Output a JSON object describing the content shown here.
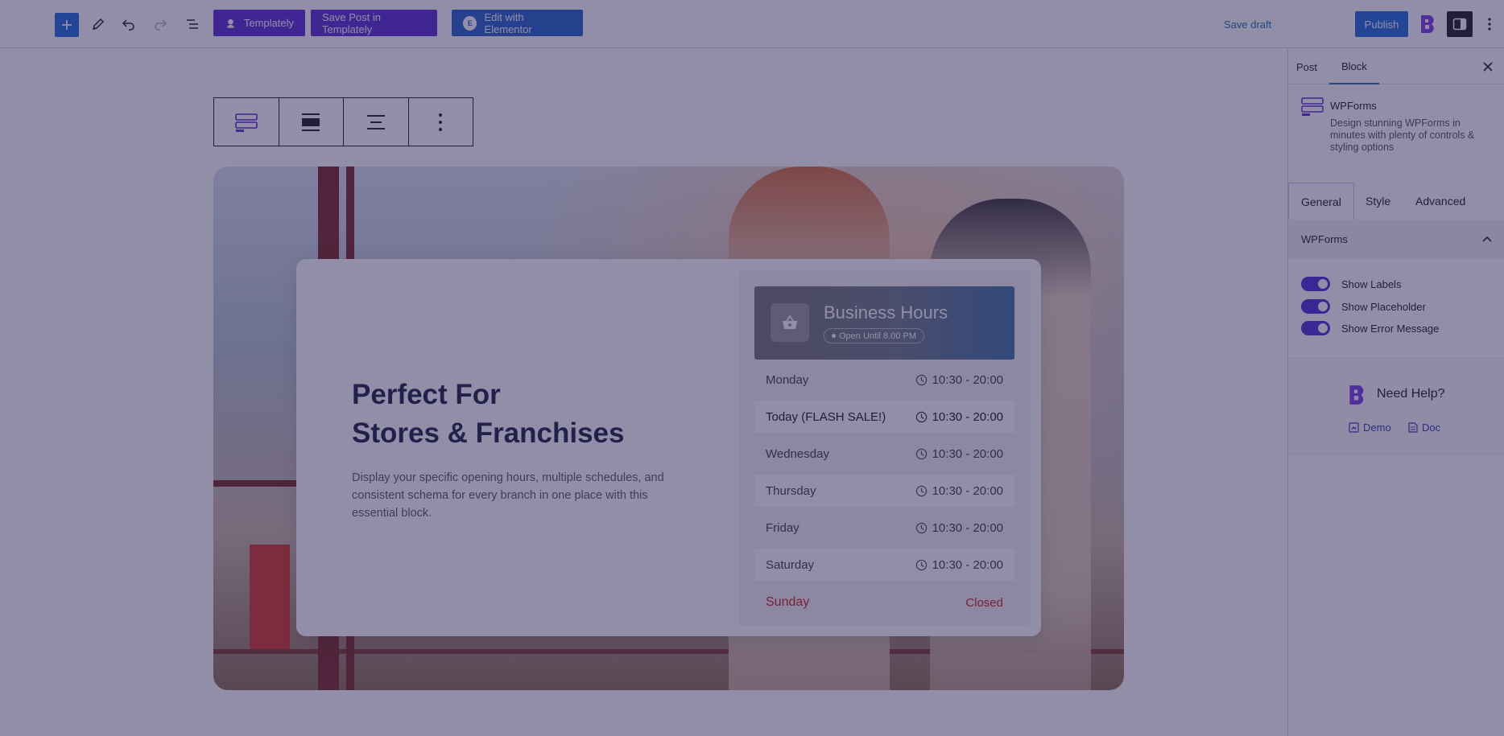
{
  "toolbar": {
    "templately_label": "Templately",
    "save_templately_label": "Save Post in Templately",
    "elementor_label": "Edit with Elementor",
    "save_draft_label": "Save draft",
    "publish_label": "Publish",
    "add_icon": "plus-icon",
    "tools_icon": "pencil-icon",
    "undo_icon": "undo-icon",
    "redo_icon": "redo-icon",
    "outline_icon": "list-view-icon"
  },
  "block_toolbar": {
    "icons": [
      "wpforms-block-icon",
      "align-full-icon",
      "align-center-icon",
      "more-options-icon"
    ]
  },
  "hero": {
    "heading_line1": "Perfect For",
    "heading_line2": "Stores & Franchises",
    "description": "Display your specific opening hours, multiple schedules, and consistent schema for every branch in one place with this essential block."
  },
  "business_hours": {
    "title": "Business Hours",
    "badge": "Open Until 8.00 PM",
    "icon": "shopping-basket-icon",
    "rows": [
      {
        "day": "Monday",
        "time": "10:30 - 20:00"
      },
      {
        "day": "Today (FLASH SALE!)",
        "time": "10:30 - 20:00"
      },
      {
        "day": "Wednesday",
        "time": "10:30 - 20:00"
      },
      {
        "day": "Thursday",
        "time": "10:30 - 20:00"
      },
      {
        "day": "Friday",
        "time": "10:30 - 20:00"
      },
      {
        "day": "Saturday",
        "time": "10:30 - 20:00"
      },
      {
        "day": "Sunday",
        "time": "Closed"
      }
    ]
  },
  "sidebar": {
    "tabs": [
      "Post",
      "Block"
    ],
    "active_tab": "Block",
    "block_name": "WPForms",
    "block_description": "Design stunning WPForms in minutes with plenty of controls & styling options",
    "sub_tabs": [
      "General",
      "Style",
      "Advanced"
    ],
    "active_sub_tab": "General",
    "panel_title": "WPForms",
    "toggles": [
      {
        "label": "Show Labels",
        "on": true
      },
      {
        "label": "Show Placeholder",
        "on": true
      },
      {
        "label": "Show Error Message",
        "on": true
      }
    ],
    "help_title": "Need Help?",
    "demo_label": "Demo",
    "doc_label": "Doc"
  },
  "colors": {
    "accent_blue": "#1e6fd9",
    "templately_purple": "#5b2ed2",
    "toggle_purple": "#4f2fd8",
    "closed_red": "#d41e1e"
  }
}
